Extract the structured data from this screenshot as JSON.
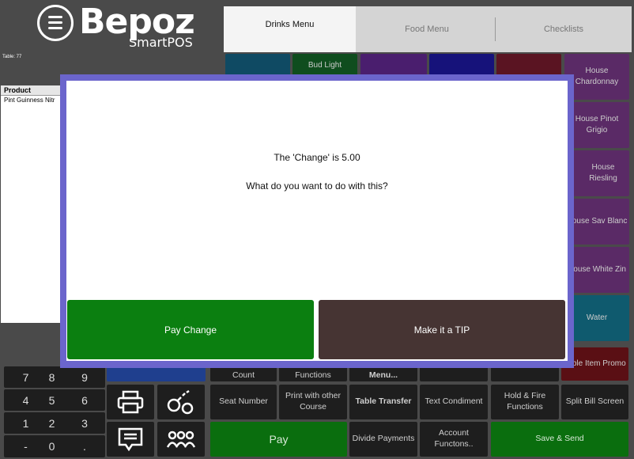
{
  "logo": {
    "brand": "Bepoz",
    "product": "SmartPOS"
  },
  "table_label": "Table: 77",
  "tabs": [
    {
      "label": "Drinks Menu"
    },
    {
      "label": "Food Menu"
    },
    {
      "label": "Checklists"
    }
  ],
  "product_list": {
    "header": "Product",
    "rows": [
      "Pint Guinness Nitr"
    ]
  },
  "top_row_buttons": [
    "Bud Light"
  ],
  "side_buttons": [
    "House Chardonnay",
    "House Pinot Grigio",
    "House Riesling",
    "House Sav Blanc",
    "House White Zin",
    "Water",
    "Table Item Promo"
  ],
  "keypad": [
    "7",
    "8",
    "9",
    "4",
    "5",
    "6",
    "1",
    "2",
    "3",
    "-",
    "0",
    "."
  ],
  "function_buttons": {
    "seat_number": "Seat Number",
    "print_other_course": "Print with other Course",
    "table_transfer": "Table Transfer",
    "text_condiment": "Text Condiment",
    "hold_fire": "Hold & Fire Functions",
    "split_bill": "Split Bill Screen",
    "pay": "Pay",
    "divide_payments": "Divide Payments",
    "account_functions": "Account Functons..",
    "save_send": "Save & Send",
    "count": "Count",
    "functions": "Functions",
    "menu": "Menu..."
  },
  "modal": {
    "message": "The 'Change' is 5.00",
    "question": "What do you want to do with this?",
    "pay_change": "Pay Change",
    "make_tip": "Make it a TIP"
  },
  "colors": {
    "modal_border": "#6b65cc",
    "pay_change_green": "#0b7f10",
    "tip_brown": "#463433",
    "pay_green": "#0a6e0e",
    "purple_button": "#5a2a66"
  }
}
